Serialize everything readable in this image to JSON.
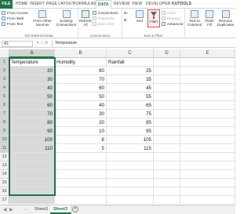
{
  "ribbon_tabs": [
    "FILE",
    "HOME",
    "INSERT",
    "PAGE LAYOUT",
    "FORMULAS",
    "DATA",
    "REVIEW",
    "VIEW",
    "DEVELOPER",
    "KUTOOLS"
  ],
  "active_tab": "DATA",
  "get_external_data": {
    "from_access": "From Access",
    "from_web": "From Web",
    "from_text": "From Text",
    "from_other_sources": "From Other Sources",
    "existing_connections": "Existing Connections",
    "label": "Get External Data"
  },
  "connections": {
    "refresh_all": "Refresh All",
    "connections": "Connections",
    "properties": "Properties",
    "edit_links": "Edit Links",
    "label": "Connections"
  },
  "sort_filter": {
    "sort": "Sort",
    "filter": "Filter",
    "clear": "Clear",
    "reapply": "Reapply",
    "advanced": "Advanced",
    "label": "Sort & Filter"
  },
  "data_tools": {
    "text_to_columns": "Text to Columns",
    "flash_fill": "Flash Fill",
    "remove_duplicates": "Remove Duplicates"
  },
  "formula_bar": {
    "name_box": "A1",
    "fx": "fx",
    "content": "Temperature"
  },
  "columns": [
    "A",
    "B",
    "C",
    "D",
    "E"
  ],
  "rows": [
    {
      "num": "1",
      "a": "Temperature",
      "b": "Humidity",
      "c": "Rainfall"
    },
    {
      "num": "2",
      "a": "20",
      "b": "80",
      "c": "25"
    },
    {
      "num": "3",
      "a": "30",
      "b": "70",
      "c": "35"
    },
    {
      "num": "4",
      "a": "40",
      "b": "60",
      "c": "45"
    },
    {
      "num": "5",
      "a": "50",
      "b": "50",
      "c": "55"
    },
    {
      "num": "6",
      "a": "60",
      "b": "40",
      "c": "65"
    },
    {
      "num": "7",
      "a": "70",
      "b": "30",
      "c": "75"
    },
    {
      "num": "8",
      "a": "80",
      "b": "20",
      "c": "85"
    },
    {
      "num": "9",
      "a": "90",
      "b": "10",
      "c": "95"
    },
    {
      "num": "10",
      "a": "100",
      "b": "8",
      "c": "105"
    },
    {
      "num": "11",
      "a": "110",
      "b": "5",
      "c": "115"
    },
    {
      "num": "12",
      "a": "",
      "b": "",
      "c": ""
    },
    {
      "num": "13",
      "a": "",
      "b": "",
      "c": ""
    },
    {
      "num": "14",
      "a": "",
      "b": "",
      "c": ""
    },
    {
      "num": "15",
      "a": "",
      "b": "",
      "c": ""
    },
    {
      "num": "16",
      "a": "",
      "b": "",
      "c": ""
    },
    {
      "num": "17",
      "a": "",
      "b": "",
      "c": ""
    }
  ],
  "sheets": [
    "Sheet1",
    "Sheet3"
  ],
  "active_sheet": "Sheet3",
  "add_sheet": "+"
}
